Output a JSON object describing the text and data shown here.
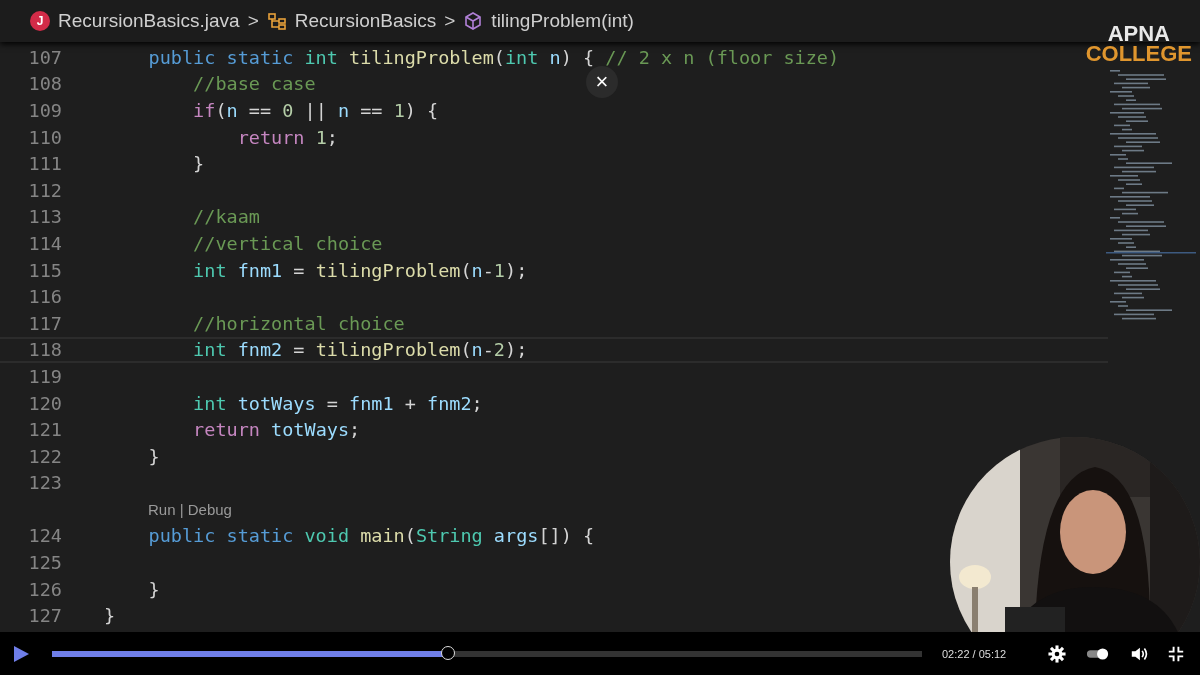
{
  "breadcrumb": {
    "file_icon_letter": "J",
    "file": "RecursionBasics.java",
    "separator": ">",
    "class": "RecursionBasics",
    "method": "tilingProblem(int)"
  },
  "close_button": "×",
  "logo": {
    "line1": "APNA",
    "line2": "COLLEGE"
  },
  "editor": {
    "rows": [
      {
        "kind": "code",
        "n": "107",
        "current": false,
        "tokens": [
          {
            "kind": "keyword",
            "t": "    public static "
          },
          {
            "kind": "type",
            "t": "int "
          },
          {
            "kind": "func",
            "t": "tilingProblem"
          },
          {
            "kind": "plain",
            "t": "("
          },
          {
            "kind": "type",
            "t": "int "
          },
          {
            "kind": "var",
            "t": "n"
          },
          {
            "kind": "plain",
            "t": ") { "
          },
          {
            "kind": "comment",
            "t": "// 2 x n (floor size)"
          }
        ]
      },
      {
        "kind": "code",
        "n": "108",
        "current": false,
        "tokens": [
          {
            "kind": "comment",
            "t": "        //base case"
          }
        ]
      },
      {
        "kind": "code",
        "n": "109",
        "current": false,
        "tokens": [
          {
            "kind": "control",
            "t": "        if"
          },
          {
            "kind": "plain",
            "t": "("
          },
          {
            "kind": "var",
            "t": "n"
          },
          {
            "kind": "plain",
            "t": " == "
          },
          {
            "kind": "number",
            "t": "0"
          },
          {
            "kind": "plain",
            "t": " || "
          },
          {
            "kind": "var",
            "t": "n"
          },
          {
            "kind": "plain",
            "t": " == "
          },
          {
            "kind": "number",
            "t": "1"
          },
          {
            "kind": "plain",
            "t": ") {"
          }
        ]
      },
      {
        "kind": "code",
        "n": "110",
        "current": false,
        "tokens": [
          {
            "kind": "control",
            "t": "            return "
          },
          {
            "kind": "number",
            "t": "1"
          },
          {
            "kind": "plain",
            "t": ";"
          }
        ]
      },
      {
        "kind": "code",
        "n": "111",
        "current": false,
        "tokens": [
          {
            "kind": "plain",
            "t": "        }"
          }
        ]
      },
      {
        "kind": "code",
        "n": "112",
        "current": false,
        "tokens": []
      },
      {
        "kind": "code",
        "n": "113",
        "current": false,
        "tokens": [
          {
            "kind": "comment",
            "t": "        //kaam"
          }
        ]
      },
      {
        "kind": "code",
        "n": "114",
        "current": false,
        "tokens": [
          {
            "kind": "comment",
            "t": "        //vertical choice"
          }
        ]
      },
      {
        "kind": "code",
        "n": "115",
        "current": false,
        "tokens": [
          {
            "kind": "type",
            "t": "        int "
          },
          {
            "kind": "var",
            "t": "fnm1"
          },
          {
            "kind": "plain",
            "t": " = "
          },
          {
            "kind": "func",
            "t": "tilingProblem"
          },
          {
            "kind": "plain",
            "t": "("
          },
          {
            "kind": "var",
            "t": "n"
          },
          {
            "kind": "plain",
            "t": "-"
          },
          {
            "kind": "number",
            "t": "1"
          },
          {
            "kind": "plain",
            "t": ");"
          }
        ]
      },
      {
        "kind": "code",
        "n": "116",
        "current": false,
        "tokens": []
      },
      {
        "kind": "code",
        "n": "117",
        "current": false,
        "tokens": [
          {
            "kind": "comment",
            "t": "        //horizontal choice"
          }
        ]
      },
      {
        "kind": "code",
        "n": "118",
        "current": true,
        "tokens": [
          {
            "kind": "type",
            "t": "        int "
          },
          {
            "kind": "var",
            "t": "fnm2"
          },
          {
            "kind": "plain",
            "t": " = "
          },
          {
            "kind": "func",
            "t": "tilingProblem"
          },
          {
            "kind": "plain",
            "t": "("
          },
          {
            "kind": "var",
            "t": "n"
          },
          {
            "kind": "plain",
            "t": "-"
          },
          {
            "kind": "number",
            "t": "2"
          },
          {
            "kind": "plain",
            "t": ");"
          }
        ]
      },
      {
        "kind": "code",
        "n": "119",
        "current": false,
        "tokens": []
      },
      {
        "kind": "code",
        "n": "120",
        "current": false,
        "tokens": [
          {
            "kind": "type",
            "t": "        int "
          },
          {
            "kind": "var",
            "t": "totWays"
          },
          {
            "kind": "plain",
            "t": " = "
          },
          {
            "kind": "var",
            "t": "fnm1"
          },
          {
            "kind": "plain",
            "t": " + "
          },
          {
            "kind": "var",
            "t": "fnm2"
          },
          {
            "kind": "plain",
            "t": ";"
          }
        ]
      },
      {
        "kind": "code",
        "n": "121",
        "current": false,
        "tokens": [
          {
            "kind": "control",
            "t": "        return "
          },
          {
            "kind": "var",
            "t": "totWays"
          },
          {
            "kind": "plain",
            "t": ";"
          }
        ]
      },
      {
        "kind": "code",
        "n": "122",
        "current": false,
        "tokens": [
          {
            "kind": "plain",
            "t": "    }"
          }
        ]
      },
      {
        "kind": "code",
        "n": "123",
        "current": false,
        "tokens": []
      },
      {
        "kind": "lens",
        "text": "Run | Debug"
      },
      {
        "kind": "code",
        "n": "124",
        "current": false,
        "tokens": [
          {
            "kind": "keyword",
            "t": "    public static "
          },
          {
            "kind": "type",
            "t": "void "
          },
          {
            "kind": "func",
            "t": "main"
          },
          {
            "kind": "plain",
            "t": "("
          },
          {
            "kind": "type",
            "t": "String "
          },
          {
            "kind": "var",
            "t": "args"
          },
          {
            "kind": "plain",
            "t": "[]) {"
          }
        ]
      },
      {
        "kind": "code",
        "n": "125",
        "current": false,
        "tokens": []
      },
      {
        "kind": "code",
        "n": "126",
        "current": false,
        "tokens": [
          {
            "kind": "plain",
            "t": "    }"
          }
        ]
      },
      {
        "kind": "code",
        "n": "127",
        "current": false,
        "tokens": [
          {
            "kind": "plain",
            "t": "}"
          }
        ]
      }
    ]
  },
  "player": {
    "playing": false,
    "progress": {
      "level": 0.455
    },
    "time": "02:22 / 05:12",
    "autoplay": {
      "on": true
    }
  }
}
